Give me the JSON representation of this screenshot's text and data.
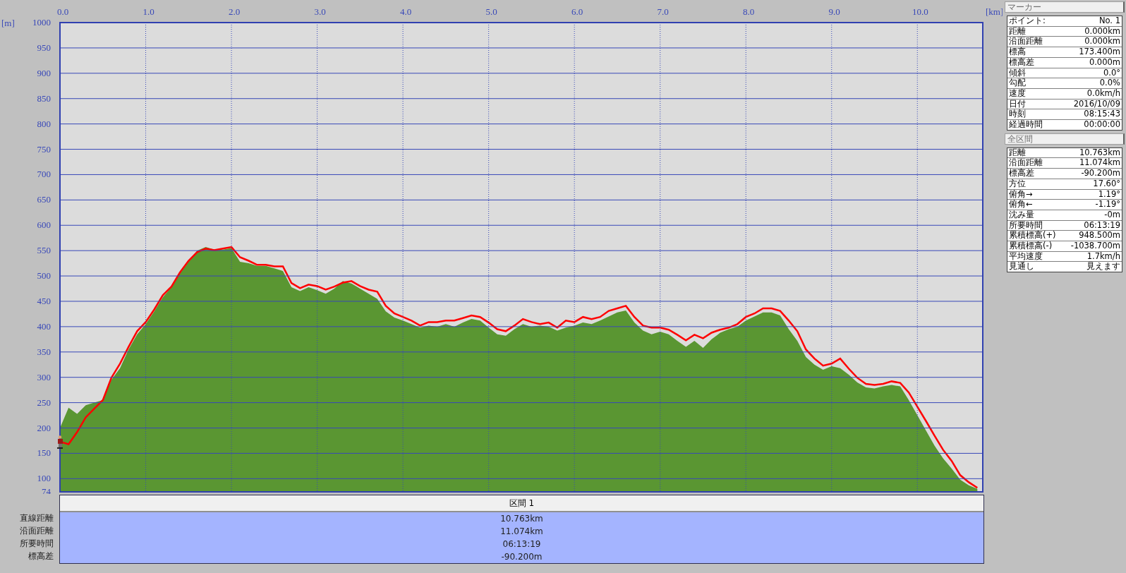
{
  "chart": {
    "chart_data": {
      "type": "area",
      "grid": true,
      "xlabel": "[km]",
      "ylabel": "[m]",
      "xlim": [
        0,
        10.763
      ],
      "ylim": [
        74,
        1000
      ],
      "xticks": [
        {
          "value": 0,
          "label": "0.0"
        },
        {
          "value": 1,
          "label": "1.0"
        },
        {
          "value": 2,
          "label": "2.0"
        },
        {
          "value": 3,
          "label": "3.0"
        },
        {
          "value": 4,
          "label": "4.0"
        },
        {
          "value": 5,
          "label": "5.0"
        },
        {
          "value": 6,
          "label": "6.0"
        },
        {
          "value": 7,
          "label": "7.0"
        },
        {
          "value": 8,
          "label": "8.0"
        },
        {
          "value": 9,
          "label": "9.0"
        },
        {
          "value": 10,
          "label": "10.0"
        }
      ],
      "yticks": [
        1000,
        950,
        900,
        850,
        800,
        750,
        700,
        650,
        600,
        550,
        500,
        450,
        400,
        350,
        300,
        250,
        200,
        150,
        100,
        74
      ],
      "x": [
        0,
        0.1,
        0.2,
        0.3,
        0.4,
        0.5,
        0.6,
        0.7,
        0.8,
        0.9,
        1,
        1.1,
        1.2,
        1.3,
        1.4,
        1.5,
        1.6,
        1.7,
        1.8,
        1.9,
        2,
        2.1,
        2.2,
        2.3,
        2.4,
        2.5,
        2.6,
        2.7,
        2.8,
        2.9,
        3,
        3.1,
        3.2,
        3.3,
        3.4,
        3.5,
        3.6,
        3.7,
        3.8,
        3.9,
        4,
        4.1,
        4.2,
        4.3,
        4.4,
        4.5,
        4.6,
        4.7,
        4.8,
        4.9,
        5,
        5.1,
        5.2,
        5.3,
        5.4,
        5.5,
        5.6,
        5.7,
        5.8,
        5.9,
        6,
        6.1,
        6.2,
        6.3,
        6.4,
        6.5,
        6.6,
        6.7,
        6.8,
        6.9,
        7,
        7.1,
        7.2,
        7.3,
        7.4,
        7.5,
        7.6,
        7.7,
        7.8,
        7.9,
        8,
        8.1,
        8.2,
        8.3,
        8.4,
        8.5,
        8.6,
        8.7,
        8.8,
        8.9,
        9,
        9.1,
        9.2,
        9.3,
        9.4,
        9.5,
        9.6,
        9.7,
        9.8,
        9.9,
        10,
        10.1,
        10.2,
        10.3,
        10.4,
        10.5,
        10.6,
        10.7
      ],
      "series": [
        {
          "type": "area",
          "color": "#5a9632",
          "values": [
            200,
            240,
            228,
            245,
            250,
            255,
            295,
            318,
            355,
            385,
            405,
            430,
            458,
            478,
            505,
            528,
            550,
            557,
            552,
            552,
            555,
            528,
            525,
            520,
            520,
            515,
            510,
            478,
            470,
            478,
            472,
            465,
            475,
            490,
            485,
            475,
            465,
            455,
            430,
            418,
            412,
            405,
            398,
            402,
            400,
            405,
            400,
            408,
            415,
            412,
            398,
            385,
            382,
            395,
            405,
            400,
            402,
            400,
            392,
            398,
            402,
            408,
            405,
            412,
            420,
            428,
            432,
            408,
            392,
            385,
            390,
            385,
            372,
            360,
            372,
            358,
            375,
            388,
            395,
            400,
            412,
            420,
            428,
            428,
            422,
            395,
            372,
            340,
            325,
            315,
            322,
            318,
            305,
            290,
            280,
            278,
            282,
            285,
            282,
            255,
            225,
            195,
            165,
            140,
            120,
            98,
            87,
            80
          ]
        },
        {
          "type": "line",
          "color": "#ff0000",
          "values": [
            173,
            168,
            192,
            221,
            238,
            255,
            299,
            327,
            360,
            391,
            409,
            434,
            462,
            479,
            507,
            530,
            547,
            554,
            551,
            554,
            557,
            537,
            530,
            522,
            522,
            519,
            519,
            486,
            476,
            483,
            480,
            473,
            479,
            487,
            490,
            480,
            473,
            469,
            441,
            426,
            419,
            412,
            402,
            409,
            409,
            412,
            412,
            417,
            422,
            419,
            408,
            395,
            391,
            402,
            415,
            409,
            405,
            408,
            398,
            412,
            409,
            419,
            415,
            419,
            431,
            436,
            441,
            419,
            402,
            398,
            398,
            394,
            384,
            373,
            384,
            377,
            388,
            394,
            398,
            405,
            419,
            426,
            436,
            436,
            431,
            412,
            391,
            355,
            337,
            323,
            327,
            337,
            317,
            299,
            287,
            285,
            287,
            292,
            289,
            270,
            242,
            214,
            185,
            157,
            135,
            107,
            93,
            82
          ]
        }
      ]
    }
  },
  "marker_panel": {
    "title": "マーカー",
    "rows": [
      {
        "label": "ポイント:",
        "value": "No. 1"
      },
      {
        "label": "距離",
        "value": "0.000km"
      },
      {
        "label": "沿面距離",
        "value": "0.000km"
      },
      {
        "label": "標高",
        "value": "173.400m"
      },
      {
        "label": "標高差",
        "value": "0.000m"
      },
      {
        "label": "傾斜",
        "value": "0.0°"
      },
      {
        "label": "勾配",
        "value": "0.0%"
      },
      {
        "label": "速度",
        "value": "0.0km/h"
      },
      {
        "label": "日付",
        "value": "2016/10/09"
      },
      {
        "label": "時刻",
        "value": "08:15:43"
      },
      {
        "label": "経過時間",
        "value": "00:00:00"
      }
    ]
  },
  "total_panel": {
    "title": "全区間",
    "rows": [
      {
        "label": "距離",
        "value": "10.763km"
      },
      {
        "label": "沿面距離",
        "value": "11.074km"
      },
      {
        "label": "標高差",
        "value": "-90.200m"
      },
      {
        "label": "方位",
        "value": "17.60°"
      },
      {
        "label": "俯角→",
        "value": "1.19°"
      },
      {
        "label": "俯角←",
        "value": "-1.19°"
      },
      {
        "label": "沈み量",
        "value": "-0m"
      },
      {
        "label": "所要時間",
        "value": "06:13:19"
      },
      {
        "label": "累積標高(+)",
        "value": "948.500m"
      },
      {
        "label": "累積標高(-)",
        "value": "-1038.700m"
      },
      {
        "label": "平均速度",
        "value": "1.7km/h"
      },
      {
        "label": "見通し",
        "value": "見えます"
      }
    ]
  },
  "section_table": {
    "header": "区間 1",
    "rows": [
      {
        "label": "直線距離",
        "value": "10.763km"
      },
      {
        "label": "沿面距離",
        "value": "11.074km"
      },
      {
        "label": "所要時間",
        "value": "06:13:19"
      },
      {
        "label": "標高差",
        "value": "-90.200m"
      }
    ]
  }
}
